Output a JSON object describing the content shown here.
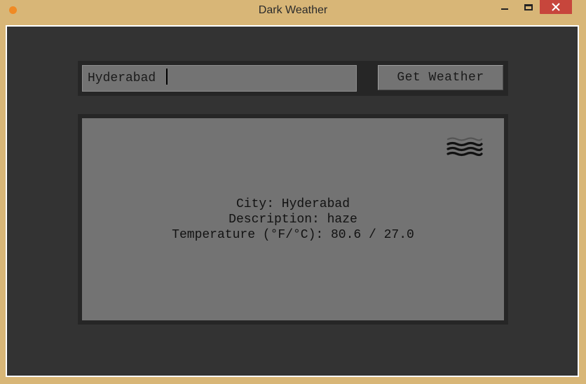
{
  "window": {
    "title": "Dark Weather"
  },
  "search": {
    "city_value": "Hyderabad",
    "button_label": "Get Weather"
  },
  "result": {
    "city_line": "City: Hyderabad",
    "description_line": "Description: haze",
    "temperature_line": "Temperature (°F/°C): 80.6 / 27.0",
    "icon": "haze-icon"
  },
  "colors": {
    "titlebar": "#d8b677",
    "close_button": "#c7463c",
    "app_background": "#333333",
    "frame": "#262626",
    "panel": "#737373",
    "text": "#1a1a1a"
  }
}
